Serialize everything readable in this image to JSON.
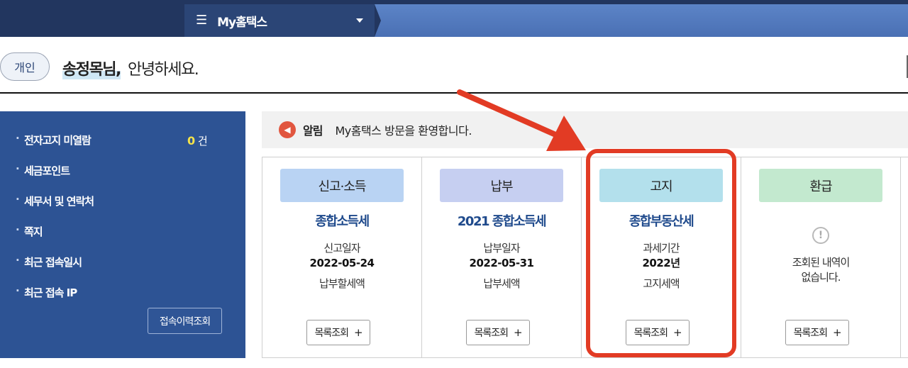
{
  "topbar": {
    "menu_title": "My홈택스"
  },
  "greeting": {
    "badge": "개인",
    "name": "송정목님,",
    "hello": "안녕하세요."
  },
  "sidebar": {
    "items": [
      {
        "label": "전자고지 미열람"
      },
      {
        "label": "세금포인트"
      },
      {
        "label": "세무서 및 연락처"
      },
      {
        "label": "쪽지"
      },
      {
        "label": "최근 접속일시"
      },
      {
        "label": "최근 접속 IP"
      }
    ],
    "unread_count": "0",
    "unread_unit": "건",
    "history_button": "접속이력조회"
  },
  "notice": {
    "label": "알림",
    "message": "My홈택스 방문을 환영합니다."
  },
  "cards": [
    {
      "header": "신고·소득",
      "header_color": "#b9d3f3",
      "tax": "종합소득세",
      "meta_label": "신고일자",
      "meta_value": "2022-05-24",
      "meta_sub": "납부할세액",
      "button": "목록조회"
    },
    {
      "header": "납부",
      "header_color": "#c6cff1",
      "tax": "2021 종합소득세",
      "meta_label": "납부일자",
      "meta_value": "2022-05-31",
      "meta_sub": "납부세액",
      "button": "목록조회"
    },
    {
      "header": "고지",
      "header_color": "#b3e0ec",
      "tax": "종합부동산세",
      "meta_label": "과세기간",
      "meta_value": "2022년",
      "meta_sub": "고지세액",
      "button": "목록조회"
    },
    {
      "header": "환급",
      "header_color": "#c3e9cf",
      "empty_line1": "조회된 내역이",
      "empty_line2": "없습니다.",
      "button": "목록조회"
    }
  ],
  "plus_symbol": "+",
  "annotation": {
    "color": "#e23b24"
  }
}
